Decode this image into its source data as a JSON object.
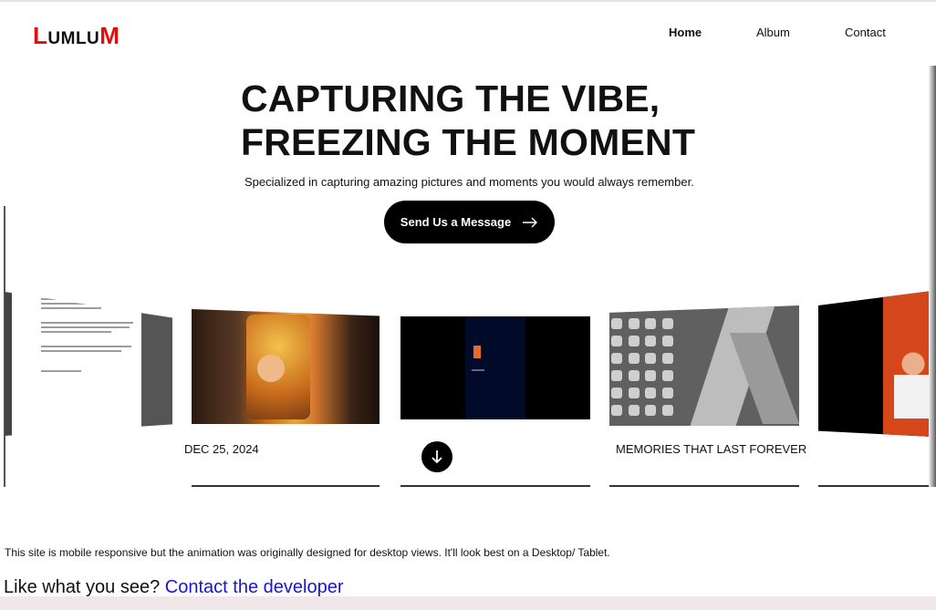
{
  "logo": {
    "first_letter": "L",
    "middle": "UMLU",
    "last_letter": "M"
  },
  "nav": {
    "home": "Home",
    "album": "Album",
    "contact": "Contact"
  },
  "hero": {
    "title_line1": "CAPTURING THE VIBE,",
    "title_line2": "FREEZING THE MOMENT",
    "subtitle": "Specialized in capturing amazing pictures and moments you would always remember.",
    "cta_label": "Send Us a Message"
  },
  "gallery": {
    "date_caption": "DEC 25, 2024",
    "tag_caption": "MEMORIES THAT LAST FOREVER"
  },
  "footer": {
    "note": "This site is mobile responsive but the animation was originally designed for desktop views. It'll look best on a Desktop/ Tablet.",
    "like_text": "Like what you see?",
    "contact_link": "Contact the developer"
  },
  "icons": {
    "cta": "arrow-right-icon",
    "scroll": "arrow-down-icon"
  },
  "colors": {
    "logo_accent": "#e01010",
    "link": "#1a14d6",
    "button_bg": "#000000"
  }
}
